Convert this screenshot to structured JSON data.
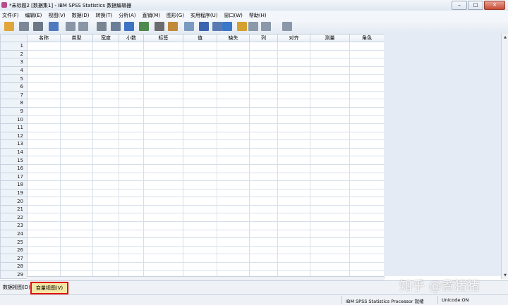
{
  "window": {
    "title": "*未标题2 [数据集1] - IBM SPSS Statistics 数据编辑器",
    "minimize_label": "–",
    "maximize_label": "□",
    "close_label": "✕"
  },
  "menu": [
    "文件(F)",
    "编辑(E)",
    "视图(V)",
    "数据(D)",
    "转换(T)",
    "分析(A)",
    "直销(M)",
    "图形(G)",
    "实用程序(U)",
    "窗口(W)",
    "帮助(H)"
  ],
  "toolbar_icons": [
    "open-icon",
    "save-icon",
    "print-icon",
    "dialog-recall-icon",
    "undo-icon",
    "redo-icon",
    "goto-case-icon",
    "goto-variable-icon",
    "variables-icon",
    "run-descriptives-icon",
    "find-icon",
    "insert-cases-icon",
    "insert-variable-icon",
    "split-file-icon",
    "weight-cases-icon",
    "select-cases-icon",
    "value-labels-icon",
    "use-sets-icon",
    "show-all-variables-icon",
    "spell-check-icon"
  ],
  "columns": [
    "名称",
    "类型",
    "宽度",
    "小数",
    "标签",
    "值",
    "缺失",
    "列",
    "对齐",
    "测量",
    "角色"
  ],
  "rows": [
    "1",
    "2",
    "3",
    "4",
    "5",
    "6",
    "7",
    "8",
    "9",
    "10",
    "11",
    "12",
    "13",
    "14",
    "15",
    "16",
    "17",
    "18",
    "19",
    "20",
    "21",
    "22",
    "23",
    "24",
    "25",
    "26",
    "27",
    "28",
    "29"
  ],
  "tabs": {
    "data_view": "数据视图(D)",
    "variable_view": "变量视图(V)"
  },
  "status": {
    "processor": "IBM SPSS Statistics Processor 就绪",
    "unicode": "Unicode:ON"
  },
  "watermark": "知乎 @煮猪猪"
}
